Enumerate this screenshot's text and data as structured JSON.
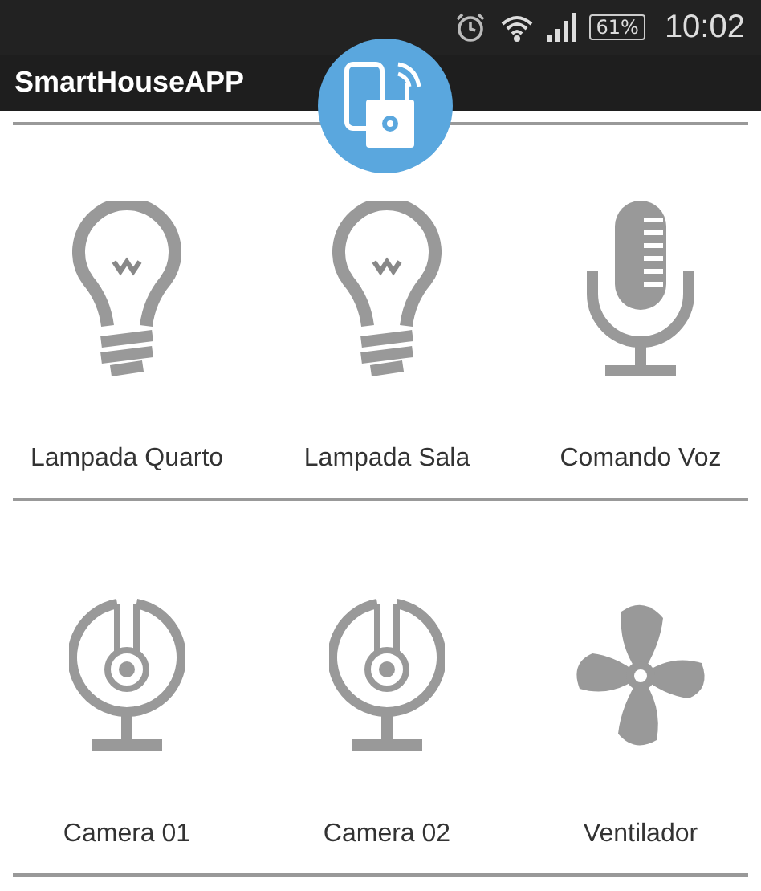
{
  "status_bar": {
    "battery": "61%",
    "time": "10:02"
  },
  "app_bar": {
    "title": "SmartHouseAPP"
  },
  "rows": [
    [
      {
        "kind": "bulb",
        "label": "Lampada Quarto"
      },
      {
        "kind": "bulb",
        "label": "Lampada Sala"
      },
      {
        "kind": "mic",
        "label": "Comando Voz"
      }
    ],
    [
      {
        "kind": "camera",
        "label": "Camera 01"
      },
      {
        "kind": "camera",
        "label": "Camera 02"
      },
      {
        "kind": "fan",
        "label": "Ventilador"
      }
    ]
  ]
}
